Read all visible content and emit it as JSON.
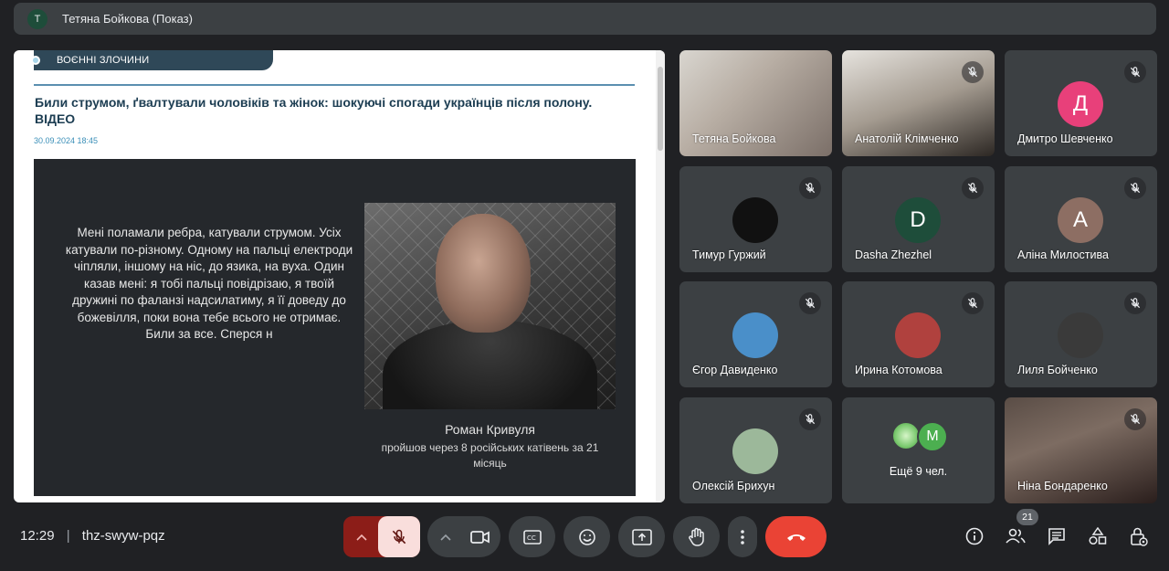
{
  "header": {
    "avatar_initial": "T",
    "title": "Тетяна Бойкова (Показ)"
  },
  "shared_screen": {
    "category_tag": "ВОЄННІ ЗЛОЧИНИ",
    "headline": "Били струмом, ґвалтували чоловіків та жінок: шокуючі спогади українців після полону. ВІДЕО",
    "date": "30.09.2024 18:45",
    "quote": "Мені поламали ребра, катували струмом. Усіх катували по-різному. Одному на пальці електроди чіпляли, іншому на ніс, до язика, на вуха. Один казав мені: я тобі пальці повідрізаю, я твоїй дружині по фаланзі надсилатиму, я її доведу до божевілля, поки вона тебе всього не отримає. Били за все. Сперся н",
    "caption_name": "Роман Кривуля",
    "caption_sub": "пройшов через 8 російських катівень за 21 місяць"
  },
  "participants": [
    {
      "name": "Тетяна Бойкова",
      "type": "video",
      "muted": false
    },
    {
      "name": "Анатолій Клімченко",
      "type": "video",
      "muted": true
    },
    {
      "name": "Дмитро Шевченко",
      "type": "initial",
      "initial": "Д",
      "color": "#e8407a",
      "muted": true
    },
    {
      "name": "Тимур Гуржий",
      "type": "avatar",
      "color": "#111111",
      "muted": true
    },
    {
      "name": "Dasha Zhezhel",
      "type": "initial",
      "initial": "D",
      "color": "#1e4d3a",
      "muted": true
    },
    {
      "name": "Аліна Милостива",
      "type": "initial",
      "initial": "A",
      "color": "#8d6e63",
      "muted": true
    },
    {
      "name": "Єгор Давиденко",
      "type": "avatar",
      "color": "#4a8fc9",
      "muted": true
    },
    {
      "name": "Ирина Котомова",
      "type": "avatar",
      "color": "#b0413e",
      "muted": true
    },
    {
      "name": "Лиля Бойченко",
      "type": "avatar",
      "color": "#3a3a3a",
      "muted": true
    },
    {
      "name": "Олексій Брихун",
      "type": "avatar",
      "color": "#9cb89a",
      "muted": true
    },
    {
      "name": "Ніна Бондаренко",
      "type": "video",
      "muted": true
    }
  ],
  "others_tile": {
    "label": "Ещё 9 чел.",
    "avatar_initial": "M"
  },
  "bottom": {
    "time": "12:29",
    "separator": "|",
    "meeting_code": "thz-swyw-pqz",
    "participants_count": "21"
  },
  "icons": {
    "mic_off": "mic-off-icon",
    "camera": "camera-icon",
    "captions": "captions-icon",
    "emoji": "emoji-icon",
    "present": "present-icon",
    "hand": "raise-hand-icon",
    "more": "more-vert-icon",
    "leave": "call-end-icon",
    "info": "info-icon",
    "people": "people-icon",
    "chat": "chat-icon",
    "activities": "activities-icon",
    "host": "host-controls-icon"
  },
  "colors": {
    "leave_red": "#ea4335",
    "mic_off_bg": "#f9dedc",
    "mic_arrow_bg": "#8c1d18",
    "panel": "#3c4043",
    "background": "#202124"
  }
}
